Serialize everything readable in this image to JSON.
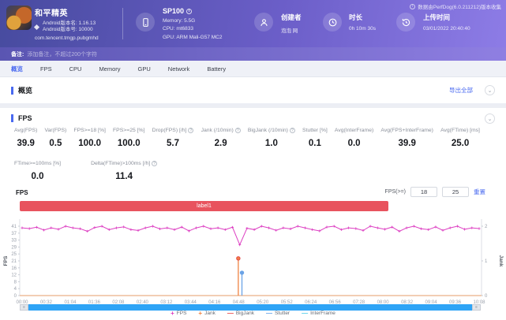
{
  "header": {
    "app": {
      "name": "和平精英",
      "version_name_label": "Android版本名: 1.16.13",
      "version_code_label": "Android版本号: 10000",
      "package": "com.tencent.tmgp.pubgmhd"
    },
    "device": {
      "model": "SP100",
      "memory": "Memory: 5.5G",
      "cpu": "CPU: mt6833",
      "gpu": "GPU: ARM Mali-G57 MC2"
    },
    "creator": {
      "label": "创建者",
      "value": "泡泡 网"
    },
    "duration": {
      "label": "时长",
      "value": "0h 10m 30s"
    },
    "upload": {
      "label": "上传时间",
      "value": "03/01/2022 20:40:40"
    },
    "collector_note": "数据由PerfDog(6.0.211212)版本收集"
  },
  "note_bar": {
    "label": "备注:",
    "placeholder": "添加备注，不超过200个字符"
  },
  "tabs": [
    {
      "label": "概览",
      "active": true
    },
    {
      "label": "FPS",
      "active": false
    },
    {
      "label": "CPU",
      "active": false
    },
    {
      "label": "Memory",
      "active": false
    },
    {
      "label": "GPU",
      "active": false
    },
    {
      "label": "Network",
      "active": false
    },
    {
      "label": "Battery",
      "active": false
    }
  ],
  "overview_section": {
    "title": "概览",
    "export_label": "导出全部"
  },
  "fps_section": {
    "title": "FPS",
    "chart_title": "FPS",
    "stats": [
      {
        "label": "Avg(FPS)",
        "value": "39.9",
        "help": false
      },
      {
        "label": "Var(FPS)",
        "value": "0.5",
        "help": false
      },
      {
        "label": "FPS>=18 [%]",
        "value": "100.0",
        "help": false
      },
      {
        "label": "FPS>=25 [%]",
        "value": "100.0",
        "help": false
      },
      {
        "label": "Drop(FPS) [/h]",
        "value": "5.7",
        "help": true
      },
      {
        "label": "Jank (/10min)",
        "value": "2.9",
        "help": true
      },
      {
        "label": "BigJank (/10min)",
        "value": "1.0",
        "help": true
      },
      {
        "label": "Stutter [%]",
        "value": "0.1",
        "help": false
      },
      {
        "label": "Avg(InterFrame)",
        "value": "0.0",
        "help": false
      },
      {
        "label": "Avg(FPS+InterFrame)",
        "value": "39.9",
        "help": false
      },
      {
        "label": "Avg(FTime) [ms]",
        "value": "25.0",
        "help": false
      }
    ],
    "stats_row2": [
      {
        "label": "FTime>=100ms [%]",
        "value": "0.0",
        "help": false
      },
      {
        "label": "Delta(FTime)>100ms [/h]",
        "value": "11.4",
        "help": true
      }
    ],
    "threshold": {
      "label": "FPS(>=)",
      "low": "18",
      "high": "25",
      "reset_label": "重置"
    }
  },
  "chart_data": {
    "type": "line",
    "title": "FPS",
    "banner_label": "label1",
    "ylabel_left": "FPS",
    "ylabel_right": "Jank",
    "ylim_left": [
      0,
      41
    ],
    "ylim_right": [
      0,
      2
    ],
    "y_ticks_left": [
      41,
      37,
      33,
      29,
      25,
      21,
      16,
      12,
      8,
      4,
      0
    ],
    "y_ticks_right": [
      2,
      1,
      0
    ],
    "x_ticks": [
      "00:00",
      "00:32",
      "01:04",
      "01:36",
      "02:08",
      "02:40",
      "03:12",
      "03:44",
      "04:16",
      "04:48",
      "05:20",
      "05:52",
      "06:24",
      "06:56",
      "07:28",
      "08:00",
      "08:32",
      "09:04",
      "09:36",
      "10:08"
    ],
    "grid": false,
    "legend_position": "bottom",
    "series": [
      {
        "name": "FPS",
        "color": "#dd3fc2",
        "marker": "plus",
        "axis": "left",
        "values": [
          40,
          39.6,
          40.4,
          38.7,
          40,
          39.2,
          41,
          40,
          39.5,
          38,
          40.2,
          41,
          39,
          40,
          40.6,
          39,
          38.5,
          40,
          41,
          39.4,
          40,
          39,
          40.5,
          38.2,
          40,
          41,
          39.5,
          40,
          39,
          40.4,
          30,
          39.8,
          39,
          41,
          40,
          38.6,
          40,
          39.4,
          41,
          40,
          39,
          38.2,
          40.5,
          41,
          39,
          40,
          39.6,
          38.5,
          41,
          40,
          39.2,
          40.5,
          38,
          40,
          41,
          39.5,
          39,
          40.6,
          38.6,
          40,
          41,
          39.2,
          40,
          39.6
        ]
      },
      {
        "name": "Jank",
        "color": "#ef8344",
        "marker": "plus",
        "axis": "right",
        "baseline": 0,
        "spike": {
          "x_frac": 0.473,
          "peak_left_scale": 22,
          "marker_color": "#e64747"
        }
      },
      {
        "name": "BigJank",
        "color": "#e64747",
        "marker": "line",
        "axis": "right",
        "baseline": 0
      },
      {
        "name": "Stutter",
        "color": "#6ba3e6",
        "marker": "line",
        "axis": "right",
        "baseline": 0,
        "spike": {
          "x_frac": 0.481,
          "peak_left_scale": 13.5,
          "marker_color": "#6ba3e6"
        }
      },
      {
        "name": "InterFrame",
        "color": "#55cde8",
        "marker": "line",
        "axis": "left",
        "baseline": 0
      }
    ],
    "baseline_overlap_color": "#eab187"
  }
}
